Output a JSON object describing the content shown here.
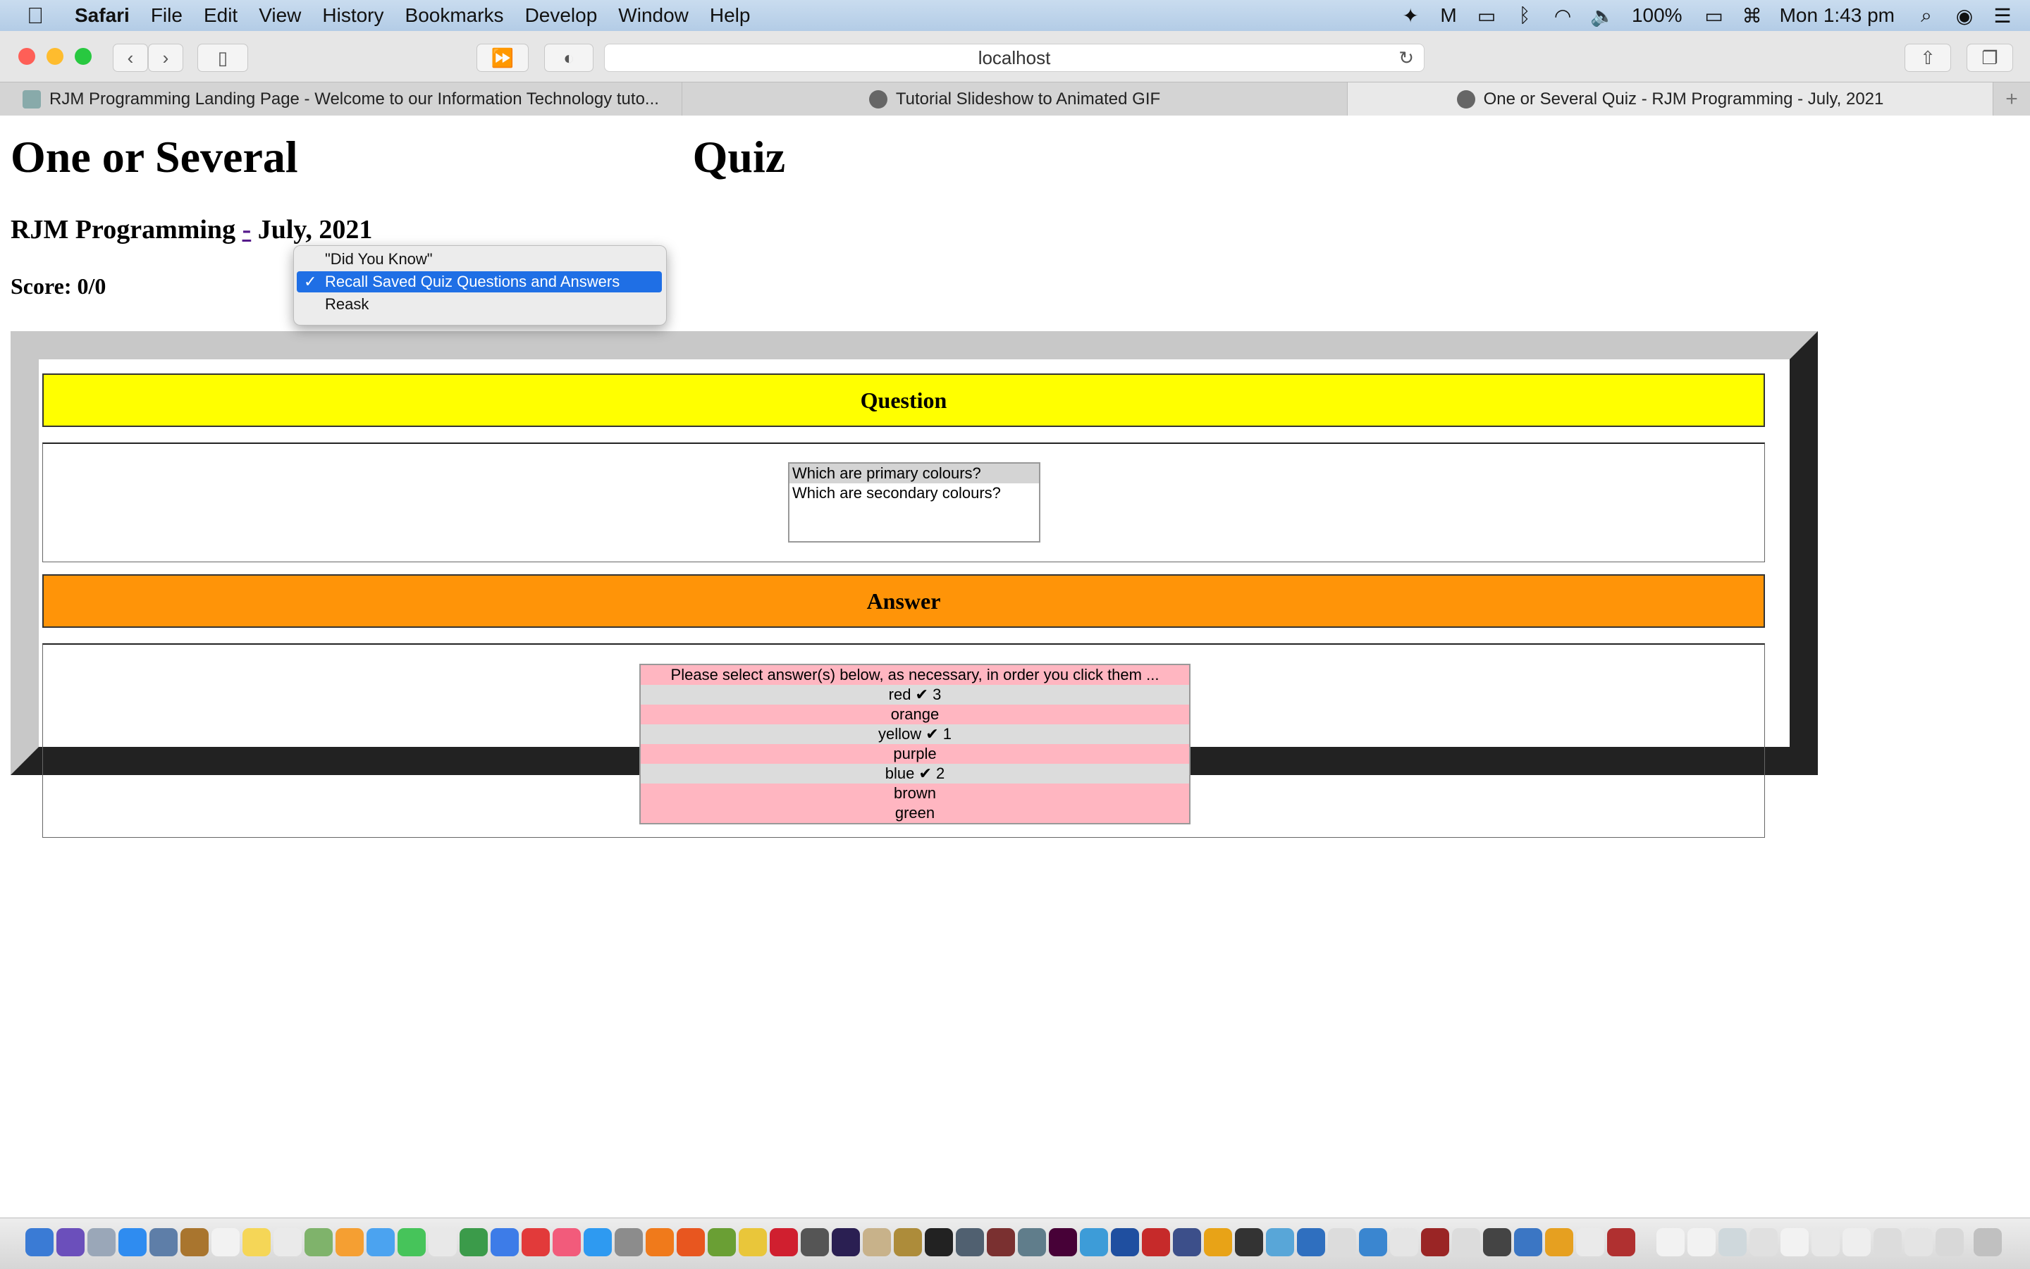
{
  "menubar": {
    "app": "Safari",
    "items": [
      "File",
      "Edit",
      "View",
      "History",
      "Bookmarks",
      "Develop",
      "Window",
      "Help"
    ],
    "battery": "100%",
    "clock": "Mon 1:43 pm"
  },
  "toolbar": {
    "address": "localhost"
  },
  "tabs": [
    {
      "title": "RJM Programming Landing Page - Welcome to our Information Technology tuto..."
    },
    {
      "title": "Tutorial Slideshow to Animated GIF"
    },
    {
      "title": "One or Several Quiz - RJM Programming - July, 2021"
    }
  ],
  "page": {
    "title_left": "One or Several",
    "title_right": "Quiz",
    "subtitle_before": "RJM Programming ",
    "subtitle_link": "-",
    "subtitle_after": " July, 2021",
    "score": "Score: 0/0",
    "question_header": "Question",
    "answer_header": "Answer",
    "questions": [
      "Which are primary colours?",
      "Which are secondary colours?"
    ],
    "answer_prompt": "Please select answer(s) below, as necessary, in order you click them ...",
    "answers": [
      "red ✔ 3",
      "orange",
      "yellow ✔ 1",
      "purple",
      "blue ✔ 2",
      "brown",
      "green"
    ]
  },
  "popup": {
    "items": [
      "\"Did You Know\"",
      "Recall Saved Quiz Questions and Answers",
      "Reask"
    ],
    "selected_index": 1
  }
}
